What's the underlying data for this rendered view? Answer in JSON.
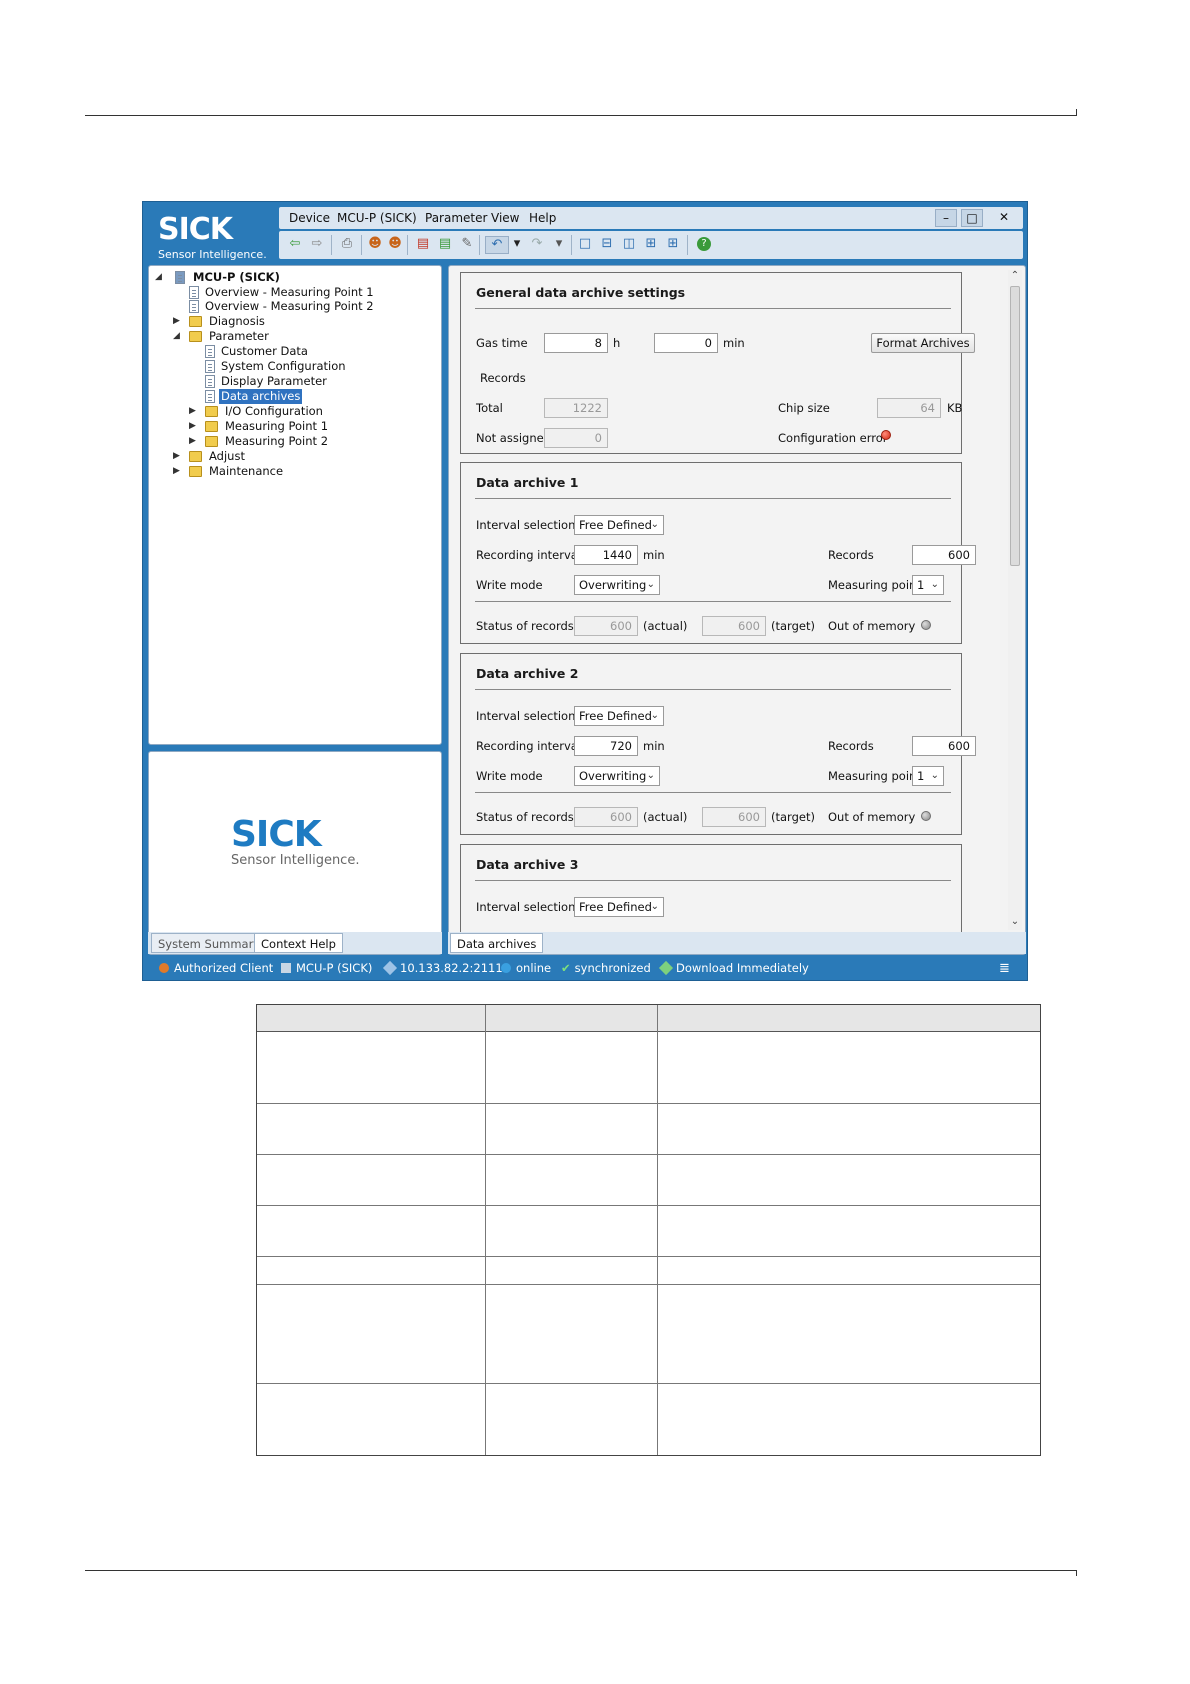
{
  "app": {
    "logo": {
      "brand": "SICK",
      "tagline": "Sensor Intelligence."
    },
    "menu": [
      "Device",
      "MCU-P (SICK)",
      "Parameter",
      "View",
      "Help"
    ],
    "window_buttons": {
      "minimize": "–",
      "maximize": "□",
      "close": "✕"
    },
    "tree": {
      "root": "MCU-P (SICK)",
      "items": [
        {
          "label": "Overview - Measuring Point 1"
        },
        {
          "label": "Overview - Measuring Point 2"
        },
        {
          "label": "Diagnosis"
        },
        {
          "label": "Parameter"
        },
        {
          "label": "Customer Data"
        },
        {
          "label": "System Configuration"
        },
        {
          "label": "Display Parameter"
        },
        {
          "label": "Data archives"
        },
        {
          "label": "I/O Configuration"
        },
        {
          "label": "Measuring Point 1"
        },
        {
          "label": "Measuring Point 2"
        },
        {
          "label": "Adjust"
        },
        {
          "label": "Maintenance"
        }
      ]
    },
    "help_panel": {
      "brand": "SICK",
      "tagline": "Sensor Intelligence."
    },
    "left_tabs": [
      "System Summary",
      "Context Help"
    ],
    "content_tab": "Data archives",
    "general": {
      "title": "General data archive settings",
      "gas_time_label": "Gas time",
      "gas_time_h": "8",
      "unit_h": "h",
      "gas_time_min": "0",
      "unit_min": "min",
      "format_button": "Format Archives",
      "records_label": "Records",
      "total_label": "Total",
      "total_value": "1222",
      "not_assigned_label": "Not assigned",
      "not_assigned_value": "0",
      "chip_size_label": "Chip size",
      "chip_size_value": "64",
      "chip_unit": "KB",
      "config_error_label": "Configuration error"
    },
    "labels": {
      "interval_selection": "Interval selection",
      "recording_interval": "Recording interval",
      "min": "min",
      "records": "Records",
      "write_mode": "Write mode",
      "measuring_point": "Measuring point",
      "status_of_records": "Status of records",
      "actual": "(actual)",
      "target": "(target)",
      "out_of_memory": "Out of memory"
    },
    "archives": [
      {
        "title": "Data archive 1",
        "interval": "Free Defined",
        "recording_interval": "1440",
        "records": "600",
        "write_mode": "Overwriting",
        "measuring_point": "1",
        "actual": "600",
        "target": "600"
      },
      {
        "title": "Data archive 2",
        "interval": "Free Defined",
        "recording_interval": "720",
        "records": "600",
        "write_mode": "Overwriting",
        "measuring_point": "1",
        "actual": "600",
        "target": "600"
      },
      {
        "title": "Data archive 3",
        "interval": "Free Defined"
      }
    ],
    "status": {
      "user": "Authorized Client",
      "device": "MCU-P (SICK)",
      "address": "10.133.82.2:2111",
      "connection": "online",
      "sync": "synchronized",
      "mode": "Download Immediately"
    },
    "colors": {
      "brand_blue": "#2a7ab8",
      "selection": "#2f72c0",
      "error_led": "#d32a16"
    }
  }
}
